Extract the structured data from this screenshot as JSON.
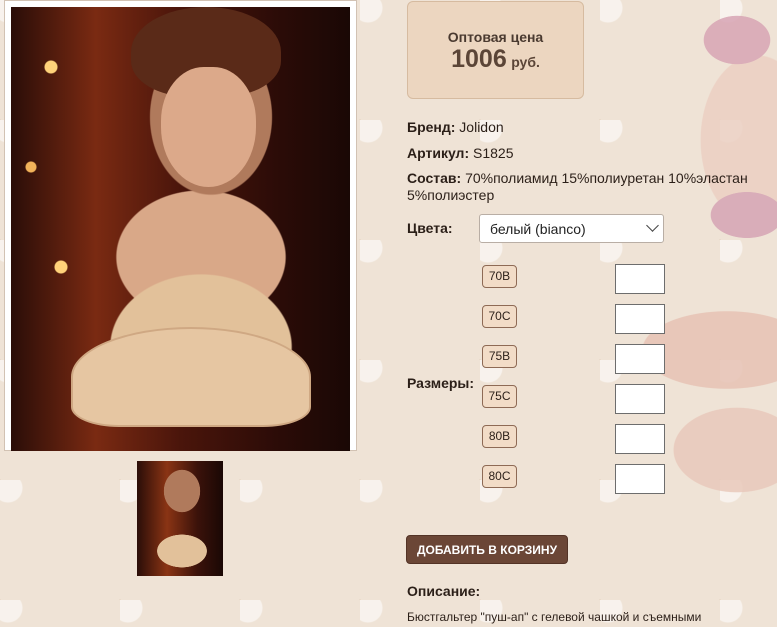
{
  "product": {
    "price_label": "Оптовая цена",
    "price_value": "1006",
    "price_currency": "руб.",
    "brand_label": "Бренд:",
    "brand_value": "Jolidon",
    "article_label": "Артикул:",
    "article_value": "S1825",
    "composition_label": "Состав:",
    "composition_value": "70%полиамид 15%полиуретан 10%эластан 5%полиэстер",
    "colors_label": "Цвета:",
    "selected_color": "белый (bianco)",
    "sizes_label": "Размеры:",
    "sizes": [
      "70B",
      "70C",
      "75B",
      "75C",
      "80B",
      "80C"
    ],
    "add_to_cart_label": "ДОБАВИТЬ В КОРЗИНУ",
    "description_title": "Описание:",
    "description_text": "Бюстгальтер \"пуш-ап\" с гелевой чашкой и съемными бретелями"
  },
  "icons": {
    "select_chevron": "chevron-down-icon"
  }
}
